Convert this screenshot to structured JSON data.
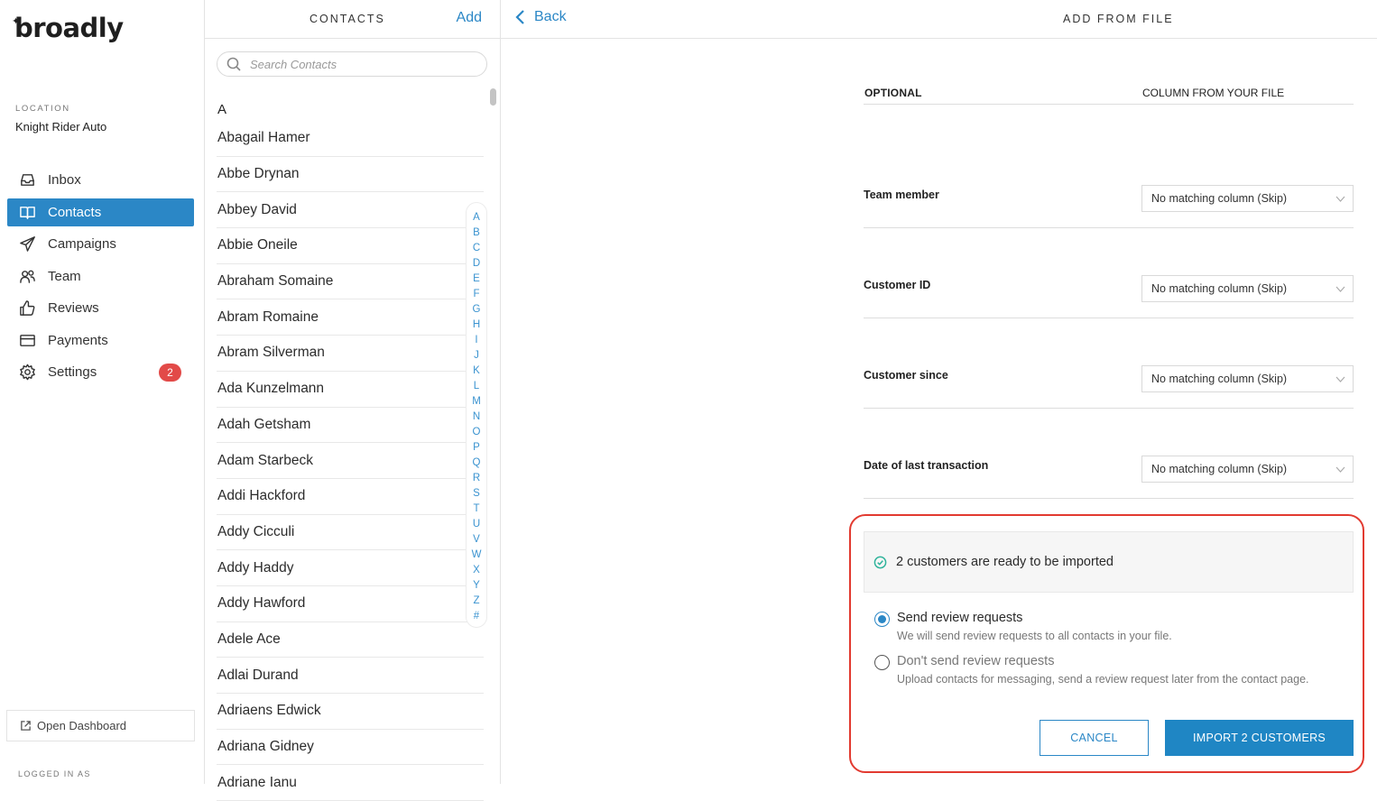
{
  "brand": {
    "name": "broadly"
  },
  "sidebar": {
    "location_label": "LOCATION",
    "location_value": "Knight Rider Auto",
    "items": [
      {
        "label": "Inbox",
        "icon": "inbox-icon"
      },
      {
        "label": "Contacts",
        "icon": "book-icon",
        "active": true
      },
      {
        "label": "Campaigns",
        "icon": "paper-plane-icon"
      },
      {
        "label": "Team",
        "icon": "users-icon"
      },
      {
        "label": "Reviews",
        "icon": "thumbs-up-icon"
      },
      {
        "label": "Payments",
        "icon": "credit-card-icon"
      },
      {
        "label": "Settings",
        "icon": "gear-icon",
        "badge": "2"
      }
    ],
    "open_dashboard": "Open Dashboard",
    "logged_in_label": "LOGGED IN AS"
  },
  "contacts": {
    "title": "CONTACTS",
    "add": "Add",
    "search_placeholder": "Search Contacts",
    "section_letter": "A",
    "names": [
      "Abagail Hamer",
      "Abbe Drynan",
      "Abbey David",
      "Abbie Oneile",
      "Abraham Somaine",
      "Abram Romaine",
      "Abram Silverman",
      "Ada Kunzelmann",
      "Adah Getsham",
      "Adam Starbeck",
      "Addi Hackford",
      "Addy Cicculi",
      "Addy Haddy",
      "Addy Hawford",
      "Adele Ace",
      "Adlai Durand",
      "Adriaens Edwick",
      "Adriana Gidney",
      "Adriane Ianu"
    ],
    "alphabet": [
      "A",
      "B",
      "C",
      "D",
      "E",
      "F",
      "G",
      "H",
      "I",
      "J",
      "K",
      "L",
      "M",
      "N",
      "O",
      "P",
      "Q",
      "R",
      "S",
      "T",
      "U",
      "V",
      "W",
      "X",
      "Y",
      "Z",
      "#"
    ]
  },
  "main": {
    "back": "Back",
    "title": "ADD FROM FILE",
    "col_optional": "OPTIONAL",
    "col_file": "COLUMN FROM YOUR FILE",
    "fields": [
      {
        "label": "Team member",
        "value": "No matching column (Skip)"
      },
      {
        "label": "Customer ID",
        "value": "No matching column (Skip)"
      },
      {
        "label": "Customer since",
        "value": "No matching column (Skip)"
      },
      {
        "label": "Date of last transaction",
        "value": "No matching column (Skip)"
      }
    ],
    "ready_text": "2 customers are ready to be imported",
    "option_send_title": "Send review requests",
    "option_send_desc": "We will send review requests to all contacts in your file.",
    "option_nosend_title": "Don't send review requests",
    "option_nosend_desc": "Upload contacts for messaging, send a review request later from the contact page.",
    "cancel": "CANCEL",
    "import": "IMPORT 2 CUSTOMERS"
  },
  "colors": {
    "accent": "#2b87c6",
    "badge": "#e24a48",
    "highlight": "#e23a30",
    "success": "#2fb39b"
  }
}
